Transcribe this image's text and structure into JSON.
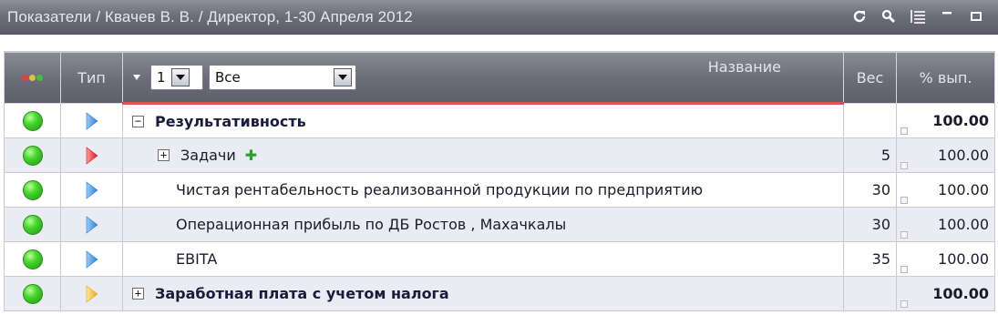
{
  "window": {
    "title": "Показатели / Квачев В. В. / Директор, 1-30 Апреля 2012",
    "tools": [
      "refresh-icon",
      "search-icon",
      "list-icon",
      "minimize-icon",
      "maximize-icon"
    ]
  },
  "grid": {
    "columns": {
      "status": "",
      "type": "Тип",
      "name": "Название",
      "weight": "Вес",
      "percent": "% вып."
    },
    "level_combo_value": "1",
    "filter_combo_value": "Все",
    "rows": [
      {
        "status": "green",
        "type_color": "blue",
        "expander": "−",
        "name": "Результативность",
        "bold": true,
        "indent": 0,
        "weight": "",
        "percent": "100.00",
        "extra": ""
      },
      {
        "status": "green",
        "type_color": "red",
        "expander": "+",
        "name": "Задачи",
        "bold": false,
        "indent": 1,
        "weight": "5",
        "percent": "100.00",
        "extra": "✚"
      },
      {
        "status": "green",
        "type_color": "blue",
        "expander": "",
        "name": "Чистая рентабельность реализованной продукции по предприятию",
        "bold": false,
        "indent": 2,
        "weight": "30",
        "percent": "100.00",
        "extra": ""
      },
      {
        "status": "green",
        "type_color": "blue",
        "expander": "",
        "name": "Операционная прибыль по ДБ Ростов , Махачкалы",
        "bold": false,
        "indent": 2,
        "weight": "30",
        "percent": "100.00",
        "extra": ""
      },
      {
        "status": "green",
        "type_color": "blue",
        "expander": "",
        "name": "EBITA",
        "bold": false,
        "indent": 2,
        "weight": "35",
        "percent": "100.00",
        "extra": ""
      },
      {
        "status": "green",
        "type_color": "yellow",
        "expander": "+",
        "name": "Заработная плата с учетом налога",
        "bold": true,
        "indent": 0,
        "weight": "",
        "percent": "100.00",
        "extra": ""
      }
    ]
  },
  "colors": {
    "header_bg": "#6c6c79",
    "accent_red": "#e05050",
    "status_green": "#46d42c",
    "type_blue": "#3f8fe0",
    "type_red": "#e03030",
    "type_yellow": "#f0c030",
    "dot_red": "#e04040",
    "dot_yellow": "#e0c040",
    "dot_green": "#40c040"
  }
}
